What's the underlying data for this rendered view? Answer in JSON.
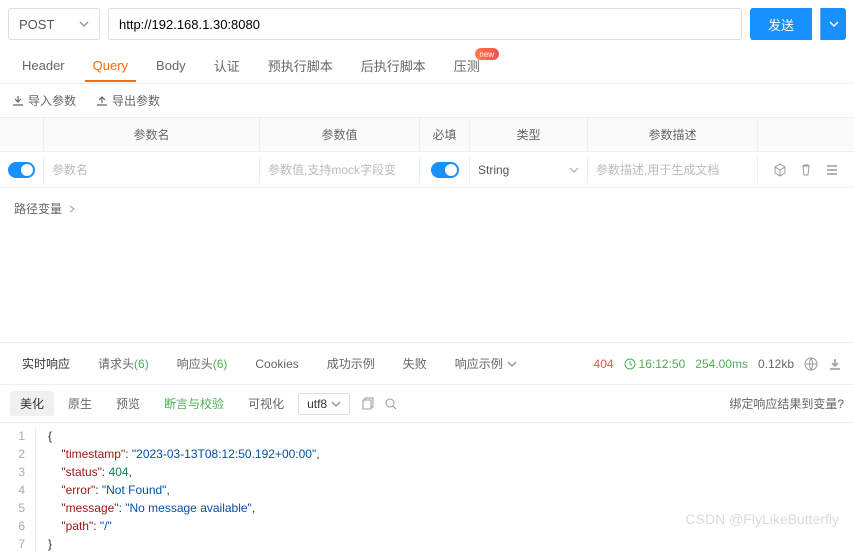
{
  "request": {
    "method": "POST",
    "url": "http://192.168.1.30:8080",
    "send_label": "发送"
  },
  "tabs": {
    "items": [
      "Header",
      "Query",
      "Body",
      "认证",
      "预执行脚本",
      "后执行脚本",
      "压测"
    ],
    "active": 1,
    "badge_label": "new"
  },
  "import_bar": {
    "in_label": "导入参数",
    "out_label": "导出参数"
  },
  "param_table": {
    "headers": {
      "name": "参数名",
      "value": "参数值",
      "req": "必填",
      "type": "类型",
      "desc": "参数描述"
    },
    "row": {
      "name_ph": "参数名",
      "value_ph": "参数值,支持mock字段变",
      "type": "String",
      "desc_ph": "参数描述,用于生成文档"
    }
  },
  "path_var_label": "路径变量",
  "response": {
    "tabs": {
      "realtime": "实时响应",
      "req_header": "请求头",
      "req_header_count": "(6)",
      "resp_header": "响应头",
      "resp_header_count": "(6)",
      "cookies": "Cookies",
      "success": "成功示例",
      "fail": "失败",
      "example": "响应示例"
    },
    "status": "404",
    "time": "16:12:50",
    "duration": "254.00ms",
    "size": "0.12kb",
    "toolbar": {
      "beautify": "美化",
      "raw": "原生",
      "preview": "预览",
      "assert": "断言与校验",
      "visual": "可视化",
      "encoding": "utf8",
      "bind_label": "绑定响应结果到变量?"
    },
    "body": {
      "lines": [
        {
          "n": 1,
          "t": "{"
        },
        {
          "n": 2,
          "t": "    \"timestamp\": \"2023-03-13T08:12:50.192+00:00\","
        },
        {
          "n": 3,
          "t": "    \"status\": 404,"
        },
        {
          "n": 4,
          "t": "    \"error\": \"Not Found\","
        },
        {
          "n": 5,
          "t": "    \"message\": \"No message available\","
        },
        {
          "n": 6,
          "t": "    \"path\": \"/\""
        },
        {
          "n": 7,
          "t": "}"
        }
      ]
    }
  },
  "watermark": "CSDN @FlyLikeButterfly"
}
